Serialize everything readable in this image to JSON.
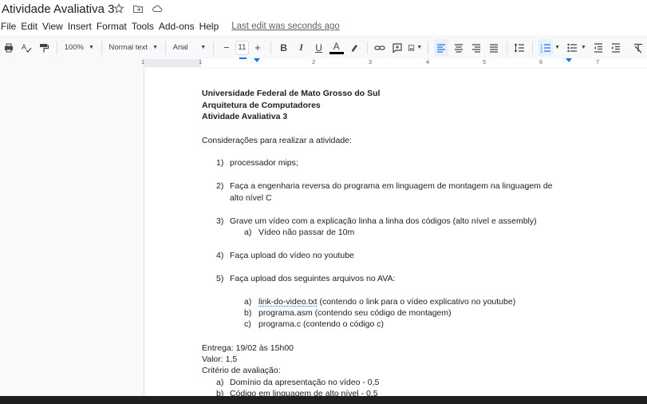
{
  "app": {
    "title": "Atividade Avaliativa 3",
    "last_edit": "Last edit was seconds ago"
  },
  "menu": [
    "File",
    "Edit",
    "View",
    "Insert",
    "Format",
    "Tools",
    "Add-ons",
    "Help"
  ],
  "toolbar": {
    "zoom": "100%",
    "style": "Normal text",
    "font": "Arial",
    "font_size": "11",
    "bold": "B",
    "italic": "I",
    "underline": "U",
    "text_color": "A",
    "accent_color": "#1a73e8"
  },
  "ruler": {
    "numbers": [
      "1",
      "1",
      "2",
      "3",
      "4",
      "5",
      "6",
      "7"
    ]
  },
  "document": {
    "header1": "Universidade Federal de Mato Grosso do Sul",
    "header2": "Arquitetura de Computadores",
    "header3": "Atividade Avaliativa 3",
    "intro": "Considerações para realizar a atividade:",
    "items": [
      {
        "num": "1)",
        "text": "processador mips;"
      },
      {
        "num": "2)",
        "text": "Faça a engenharia reversa do programa em linguagem de montagem na linguagem de",
        "text2": "alto nível C"
      },
      {
        "num": "3)",
        "text": "Grave um vídeo com a explicação linha a linha dos códigos (alto nível e assembly)"
      },
      {
        "num": "4)",
        "text": "Faça upload do vídeo no youtube"
      },
      {
        "num": "5)",
        "text": "Faça upload dos seguintes arquivos no AVA:"
      }
    ],
    "sub3": {
      "num": "a)",
      "text": "Vídeo não passar de 10m"
    },
    "sub5": [
      {
        "num": "a)",
        "link": "link-do-video.txt",
        "text": " (contendo o link para o vídeo explicativo no youtube)"
      },
      {
        "num": "b)",
        "text": "programa.asm (contendo seu código de montagem)"
      },
      {
        "num": "c)",
        "text": "programa.c (contendo o código c)"
      }
    ],
    "entrega": "Entrega: 19/02 às 15h00",
    "valor": "Valor: 1,5",
    "criterio": "Critério de avaliação:",
    "criterios": [
      {
        "num": "a)",
        "text": "Domínio da apresentação no vídeo - 0,5"
      },
      {
        "num": "b)",
        "text": "Código em linguagem de alto nível - 0,5"
      }
    ]
  }
}
